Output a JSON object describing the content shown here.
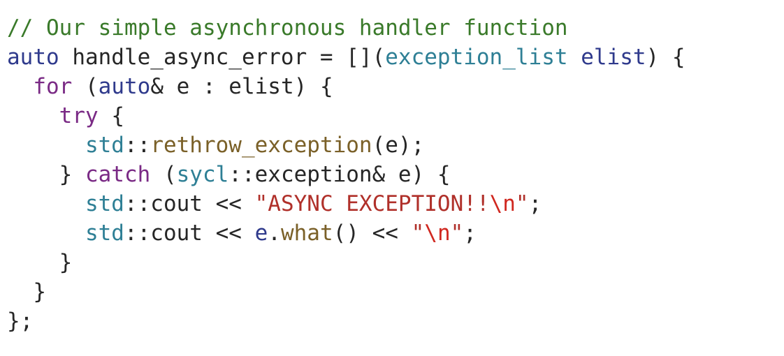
{
  "code": {
    "language": "C++",
    "colors": {
      "plain": "#262626",
      "comment": "#3a7a2a",
      "keyword": "#2f3a8c",
      "control": "#7a2a85",
      "type": "#2e7f95",
      "function": "#7a6028",
      "string": "#b0302a",
      "escape": "#d02820"
    },
    "lines": [
      [
        {
          "t": "// Our simple asynchronous handler function",
          "c": "comment"
        }
      ],
      [
        {
          "t": "auto",
          "c": "keyword"
        },
        {
          "t": " handle_async_error = [](",
          "c": "plain"
        },
        {
          "t": "exception_list",
          "c": "type"
        },
        {
          "t": " ",
          "c": "plain"
        },
        {
          "t": "elist",
          "c": "keyword"
        },
        {
          "t": ") {",
          "c": "plain"
        }
      ],
      [
        {
          "t": "  ",
          "c": "plain"
        },
        {
          "t": "for",
          "c": "control"
        },
        {
          "t": " (",
          "c": "plain"
        },
        {
          "t": "auto",
          "c": "keyword"
        },
        {
          "t": "& e : elist) {",
          "c": "plain"
        }
      ],
      [
        {
          "t": "    ",
          "c": "plain"
        },
        {
          "t": "try",
          "c": "control"
        },
        {
          "t": " {",
          "c": "plain"
        }
      ],
      [
        {
          "t": "      ",
          "c": "plain"
        },
        {
          "t": "std",
          "c": "type"
        },
        {
          "t": "::",
          "c": "plain"
        },
        {
          "t": "rethrow_exception",
          "c": "function"
        },
        {
          "t": "(e);",
          "c": "plain"
        }
      ],
      [
        {
          "t": "    } ",
          "c": "plain"
        },
        {
          "t": "catch",
          "c": "control"
        },
        {
          "t": " (",
          "c": "plain"
        },
        {
          "t": "sycl",
          "c": "type"
        },
        {
          "t": "::exception& e) {",
          "c": "plain"
        }
      ],
      [
        {
          "t": "      ",
          "c": "plain"
        },
        {
          "t": "std",
          "c": "type"
        },
        {
          "t": "::cout << ",
          "c": "plain"
        },
        {
          "t": "\"ASYNC EXCEPTION!!",
          "c": "string"
        },
        {
          "t": "\\n",
          "c": "escape"
        },
        {
          "t": "\"",
          "c": "string"
        },
        {
          "t": ";",
          "c": "plain"
        }
      ],
      [
        {
          "t": "      ",
          "c": "plain"
        },
        {
          "t": "std",
          "c": "type"
        },
        {
          "t": "::cout << ",
          "c": "plain"
        },
        {
          "t": "e",
          "c": "keyword"
        },
        {
          "t": ".",
          "c": "plain"
        },
        {
          "t": "what",
          "c": "function"
        },
        {
          "t": "() << ",
          "c": "plain"
        },
        {
          "t": "\"",
          "c": "string"
        },
        {
          "t": "\\n",
          "c": "escape"
        },
        {
          "t": "\"",
          "c": "string"
        },
        {
          "t": ";",
          "c": "plain"
        }
      ],
      [
        {
          "t": "    }",
          "c": "plain"
        }
      ],
      [
        {
          "t": "  }",
          "c": "plain"
        }
      ],
      [
        {
          "t": "};",
          "c": "plain"
        }
      ]
    ]
  }
}
